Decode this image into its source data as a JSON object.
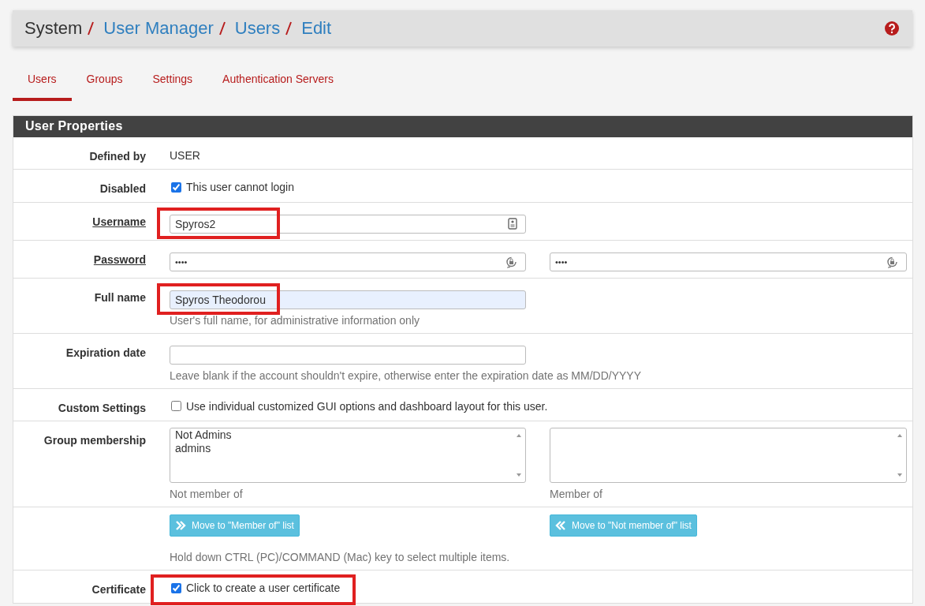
{
  "breadcrumb": [
    {
      "label": "System",
      "link": false
    },
    {
      "label": "User Manager",
      "link": true
    },
    {
      "label": "Users",
      "link": true
    },
    {
      "label": "Edit",
      "link": true
    }
  ],
  "tabs": [
    {
      "label": "Users",
      "selected": true
    },
    {
      "label": "Groups",
      "selected": false
    },
    {
      "label": "Settings",
      "selected": false
    },
    {
      "label": "Authentication Servers",
      "selected": false
    }
  ],
  "panel": {
    "title": "User Properties",
    "rows": [
      {
        "kind": "text",
        "label": "Defined by",
        "value": "USER"
      },
      {
        "kind": "checkbox",
        "label": "Disabled",
        "checked": true,
        "text": "This user cannot login"
      },
      {
        "kind": "input",
        "label": "Username",
        "underlined": true,
        "value": "Spyros2",
        "highlighted": true
      },
      {
        "kind": "password",
        "label": "Password",
        "underlined": true,
        "values": [
          "••••",
          "••••"
        ]
      },
      {
        "kind": "input",
        "label": "Full name",
        "value": "Spyros Theodorou",
        "autofilled": true,
        "help": "User's full name, for administrative information only",
        "highlighted": true
      },
      {
        "kind": "input",
        "label": "Expiration date",
        "value": "",
        "help": "Leave blank if the account shouldn't expire, otherwise enter the expiration date as MM/DD/YYYY"
      },
      {
        "kind": "checkbox",
        "label": "Custom Settings",
        "checked": false,
        "text": "Use individual customized GUI options and dashboard layout for this user."
      },
      {
        "kind": "lists",
        "label": "Group membership",
        "lists": [
          {
            "options": [
              "Not Admins",
              "admins"
            ],
            "caption": "Not member of"
          },
          {
            "caption": "Member of"
          }
        ]
      },
      {
        "kind": "buttons",
        "buttons": [
          {
            "label": "Move to \"Member of\" list"
          },
          {
            "label": "Move to \"Not member of\" list"
          }
        ],
        "help": "Hold down CTRL (PC)/COMMAND (Mac) key to select multiple items."
      },
      {
        "kind": "checkbox",
        "label": "Certificate",
        "checked": true,
        "text": "Click to create a user certificate",
        "highlighted": true
      }
    ]
  }
}
